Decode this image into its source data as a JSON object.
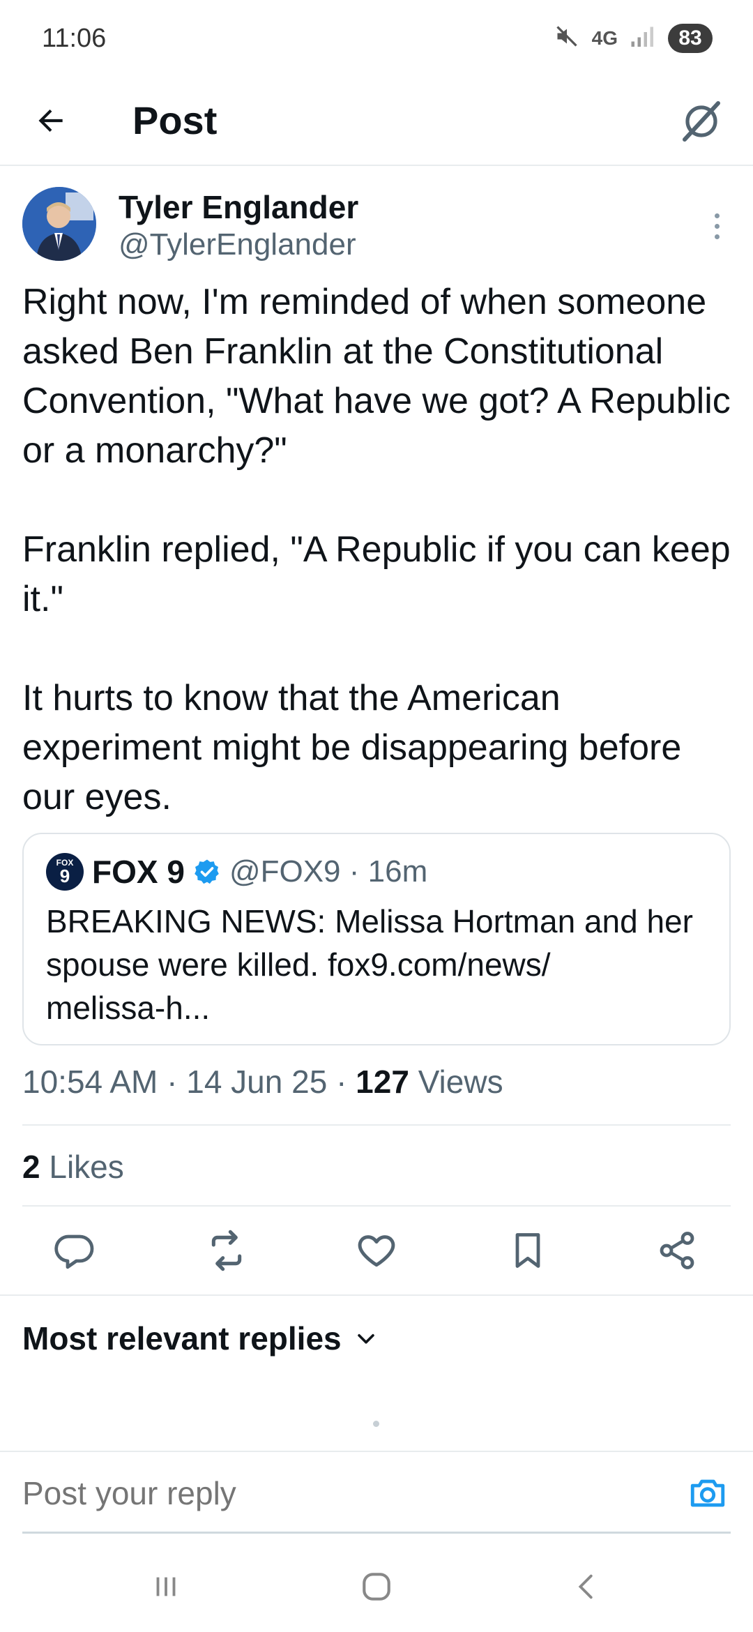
{
  "status_bar": {
    "time": "11:06",
    "network": "4G",
    "battery": "83"
  },
  "app_bar": {
    "title": "Post"
  },
  "post": {
    "author_name": "Tyler Englander",
    "author_handle": "@TylerEnglander",
    "text": "Right now, I'm reminded of when someone asked Ben Franklin at the Constitutional Convention, \"What have we got? A Republic or a monarchy?\"\n\nFranklin replied, \"A Republic if you can keep it.\"\n\nIt hurts to know that the American experiment might be disappearing before our eyes.",
    "quote": {
      "logo_top": "FOX",
      "logo_number": "9",
      "name": "FOX 9",
      "handle_time": "@FOX9 · 16m",
      "text": "BREAKING NEWS: Melissa Hortman and her spouse were killed.  fox9.com/news/\nmelissa-h..."
    },
    "timestamp": "10:54 AM · 14 Jun 25 · ",
    "views_count": "127",
    "views_label": " Views",
    "likes_count": "2",
    "likes_label": " Likes"
  },
  "replies": {
    "sort_label": "Most relevant replies"
  },
  "reply_bar": {
    "placeholder": "Post your reply"
  },
  "colors": {
    "accent": "#1d9bf0",
    "text": "#0f1419",
    "secondary": "#536471"
  }
}
